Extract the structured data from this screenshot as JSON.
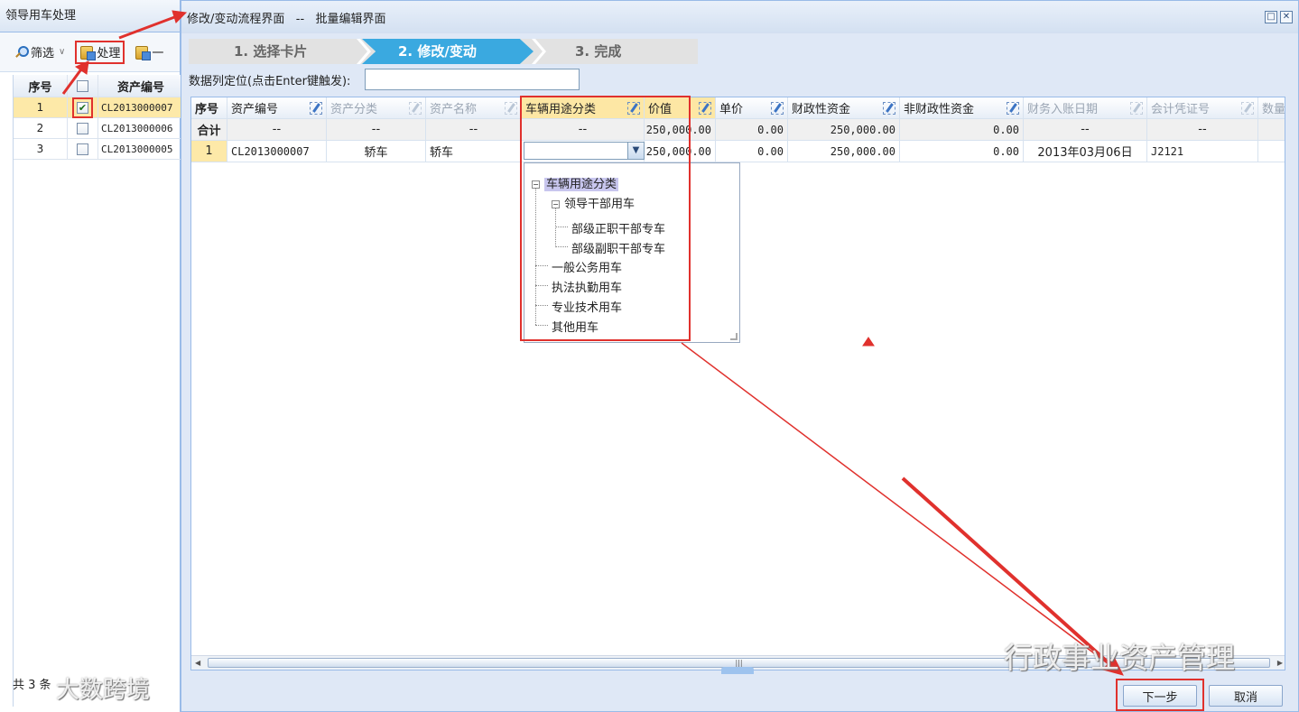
{
  "left": {
    "title": "领导用车处理",
    "filter_label": "筛选",
    "process_label": "处理",
    "extra_label": "一",
    "columns": [
      "序号",
      "资产编号"
    ],
    "rows": [
      {
        "idx": "1",
        "code": "CL2013000007",
        "checked": true
      },
      {
        "idx": "2",
        "code": "CL2013000006",
        "checked": false
      },
      {
        "idx": "3",
        "code": "CL2013000005",
        "checked": false
      }
    ],
    "footer": "共 3 条"
  },
  "dialog": {
    "title": "修改/变动流程界面   --   批量编辑界面",
    "steps": [
      "1.  选择卡片",
      "2. 修改/变动",
      "3. 完成"
    ],
    "locator_label": "数据列定位(点击Enter键触发):",
    "locator_value": "",
    "columns": [
      "序号",
      "资产编号",
      "资产分类",
      "资产名称",
      "车辆用途分类",
      "价值",
      "单价",
      "财政性资金",
      "非财政性资金",
      "财务入账日期",
      "会计凭证号",
      "数量"
    ],
    "sum_row": {
      "label": "合计",
      "code": "--",
      "cat": "--",
      "name": "--",
      "use": "--",
      "value": "250,000.00",
      "unit": "0.00",
      "fiscal": "250,000.00",
      "nonfiscal": "0.00",
      "date": "--",
      "voucher": "--"
    },
    "data_row": {
      "idx": "1",
      "code": "CL2013000007",
      "cat": "轿车",
      "name": "轿车",
      "use": "",
      "value": "250,000.00",
      "unit": "0.00",
      "fiscal": "250,000.00",
      "nonfiscal": "0.00",
      "date": "2013年03月06日",
      "voucher": "J2121"
    },
    "tree": {
      "root": "车辆用途分类",
      "leader": "领导干部用车",
      "leader_children": [
        "部级正职干部专车",
        "部级副职干部专车"
      ],
      "others": [
        "一般公务用车",
        "执法执勤用车",
        "专业技术用车",
        "其他用车"
      ]
    },
    "next_label": "下一步",
    "cancel_label": "取消"
  },
  "watermarks": {
    "left": "大数跨境",
    "right": "行政事业资产管理"
  },
  "colors": {
    "highlight_red": "#e0312d",
    "active_step": "#3aa9e0",
    "selected_row": "#fde9a8"
  }
}
